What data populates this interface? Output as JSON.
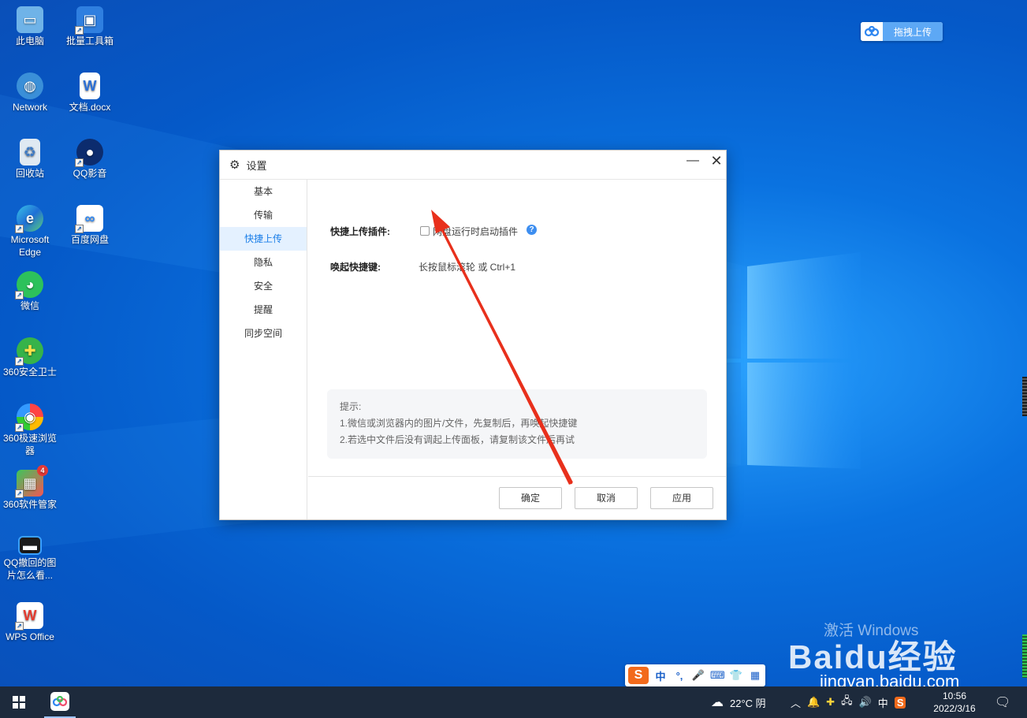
{
  "desktop": {
    "icons": [
      {
        "label": "此电脑"
      },
      {
        "label": "批量工具箱"
      },
      {
        "label": "Network"
      },
      {
        "label": "文档.docx"
      },
      {
        "label": "回收站"
      },
      {
        "label": "QQ影音"
      },
      {
        "label": "Microsoft Edge"
      },
      {
        "label": "百度网盘"
      },
      {
        "label": "微信"
      },
      {
        "label": "360安全卫士"
      },
      {
        "label": "360极速浏览器"
      },
      {
        "label": "360软件管家",
        "badge": "4"
      },
      {
        "label": "QQ撤回的图片怎么看..."
      },
      {
        "label": "WPS Office"
      }
    ]
  },
  "drag_upload": {
    "label": "拖拽上传"
  },
  "dialog": {
    "title": "设置",
    "nav": [
      "基本",
      "传输",
      "快捷上传",
      "隐私",
      "安全",
      "提醒",
      "同步空间"
    ],
    "active_nav": "快捷上传",
    "plugin_label": "快捷上传插件:",
    "plugin_checkbox": "网盘运行时启动插件",
    "plugin_checked": false,
    "hotkey_label": "唤起快捷键:",
    "hotkey_value": "长按鼠标滚轮 或 Ctrl+1",
    "tips_title": "提示:",
    "tip1": "1.微信或浏览器内的图片/文件，先复制后，再唤起快捷键",
    "tip2": "2.若选中文件后没有调起上传面板，请复制该文件后再试",
    "ok": "确定",
    "cancel": "取消",
    "apply": "应用"
  },
  "ime": {
    "logo": "S",
    "items": [
      "中",
      "°,",
      "🎤",
      "⌨",
      "👕",
      "▦"
    ]
  },
  "watermark": {
    "activate": "激活 Windows",
    "brand": "Baidu经验",
    "url": "jingyan.baidu.com"
  },
  "taskbar": {
    "weather": "22°C 阴",
    "ime_lang": "中",
    "time": "10:56",
    "date": "2022/3/16"
  },
  "colors": {
    "accent": "#1a7ee8",
    "arrow": "#e8301c",
    "taskbar": "#1d2a3c"
  }
}
